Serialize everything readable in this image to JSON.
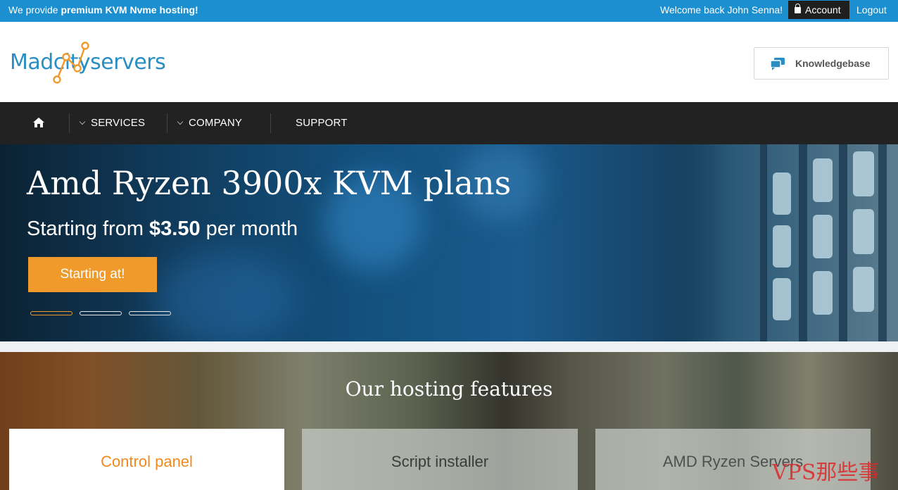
{
  "topbar": {
    "tagline_prefix": "We provide",
    "tagline_bold": "premium KVM Nvme hosting!",
    "welcome": "Welcome back John Senna!",
    "account": "Account",
    "logout": "Logout"
  },
  "header": {
    "logo_text": "Madcityservers",
    "knowledgebase": "Knowledgebase"
  },
  "nav": {
    "items": [
      {
        "label": "SERVICES"
      },
      {
        "label": "COMPANY"
      },
      {
        "label": "SUPPORT"
      }
    ]
  },
  "hero": {
    "title": "Amd Ryzen 3900x KVM plans",
    "subtitle_prefix": "Starting from",
    "price": "$3.50",
    "subtitle_suffix": "per month",
    "cta": "Starting at!",
    "slides": 3,
    "active_slide": 1
  },
  "features": {
    "heading": "Our hosting features",
    "cards": [
      {
        "title": "Control panel"
      },
      {
        "title": "Script installer"
      },
      {
        "title": "AMD Ryzen Servers"
      }
    ]
  },
  "watermark": "VPS那些事",
  "colors": {
    "topbar": "#1b8fcf",
    "nav": "#222222",
    "accent": "#ef9a2b",
    "logo": "#2a8ec3"
  }
}
